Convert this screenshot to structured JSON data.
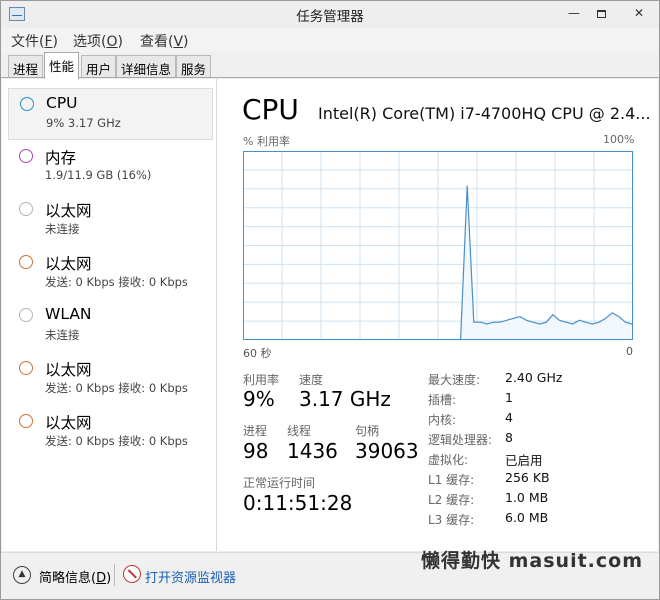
{
  "window": {
    "title": "任务管理器",
    "min_glyph": "—",
    "close_glyph": "✕"
  },
  "menu": [
    {
      "label": "文件(",
      "key": "F",
      "end": ")"
    },
    {
      "label": "选项(",
      "key": "O",
      "end": ")"
    },
    {
      "label": "查看(",
      "key": "V",
      "end": ")"
    }
  ],
  "tabs": [
    "进程",
    "性能",
    "用户",
    "详细信息",
    "服务"
  ],
  "active_tab": "性能",
  "sidebar": {
    "items": [
      {
        "name": "CPU",
        "sub": "9%  3.17 GHz",
        "color": "#2b8cc4"
      },
      {
        "name": "内存",
        "sub": "1.9/11.9 GB (16%)",
        "color": "#a347b5"
      },
      {
        "name": "以太网",
        "sub": "未连接",
        "color": "#b5b5b5"
      },
      {
        "name": "以太网",
        "sub": "发送: 0 Kbps 接收: 0 Kbps",
        "color": "#c8743a"
      },
      {
        "name": "WLAN",
        "sub": "未连接",
        "color": "#b5b5b5"
      },
      {
        "name": "以太网",
        "sub": "发送: 0 Kbps 接收: 0 Kbps",
        "color": "#c8743a"
      },
      {
        "name": "以太网",
        "sub": "发送: 0 Kbps 接收: 0 Kbps",
        "color": "#c8743a"
      }
    ]
  },
  "main": {
    "heading": "CPU",
    "model": "Intel(R) Core(TM) i7-4700HQ CPU @ 2.4...",
    "graph_label": "% 利用率",
    "graph_max": "100%",
    "axis_left": "60 秒",
    "axis_right": "0",
    "stats": {
      "utilization_label": "利用率",
      "utilization_value": "9%",
      "speed_label": "速度",
      "speed_value": "3.17 GHz",
      "processes_label": "进程",
      "processes_value": "98",
      "threads_label": "线程",
      "threads_value": "1436",
      "handles_label": "句柄",
      "handles_value": "39063",
      "uptime_label": "正常运行时间",
      "uptime_value": "0:11:51:28"
    },
    "details": [
      {
        "label": "最大速度:",
        "value": "2.40 GHz"
      },
      {
        "label": "插槽:",
        "value": "1"
      },
      {
        "label": "内核:",
        "value": "4"
      },
      {
        "label": "逻辑处理器:",
        "value": "8"
      },
      {
        "label": "虚拟化:",
        "value": "已启用"
      },
      {
        "label": "L1 缓存:",
        "value": "256 KB"
      },
      {
        "label": "L2 缓存:",
        "value": "1.0 MB"
      },
      {
        "label": "L3 缓存:",
        "value": "6.0 MB"
      }
    ]
  },
  "footer": {
    "fewer_label": "简略信息(",
    "fewer_key": "D",
    "fewer_end": ")",
    "monitor_link": "打开资源监视器"
  },
  "watermark": "懒得勤快  masuit.com",
  "colors": {
    "graph_line": "#4a8fc9",
    "graph_fill": "#f1f7fc",
    "graph_grid": "#cfe3f3",
    "graph_border": "#4a8fc9"
  },
  "cpu_history": [
    0,
    0,
    0,
    0,
    0,
    0,
    0,
    0,
    0,
    0,
    0,
    0,
    0,
    0,
    0,
    0,
    0,
    0,
    0,
    0,
    0,
    0,
    0,
    0,
    0,
    0,
    0,
    0,
    0,
    0,
    0,
    0,
    0,
    0,
    82,
    9,
    9,
    8,
    9,
    9,
    10,
    11,
    12,
    10,
    9,
    8,
    9,
    13,
    10,
    9,
    8,
    10,
    9,
    8,
    9,
    11,
    14,
    12,
    9,
    8
  ]
}
